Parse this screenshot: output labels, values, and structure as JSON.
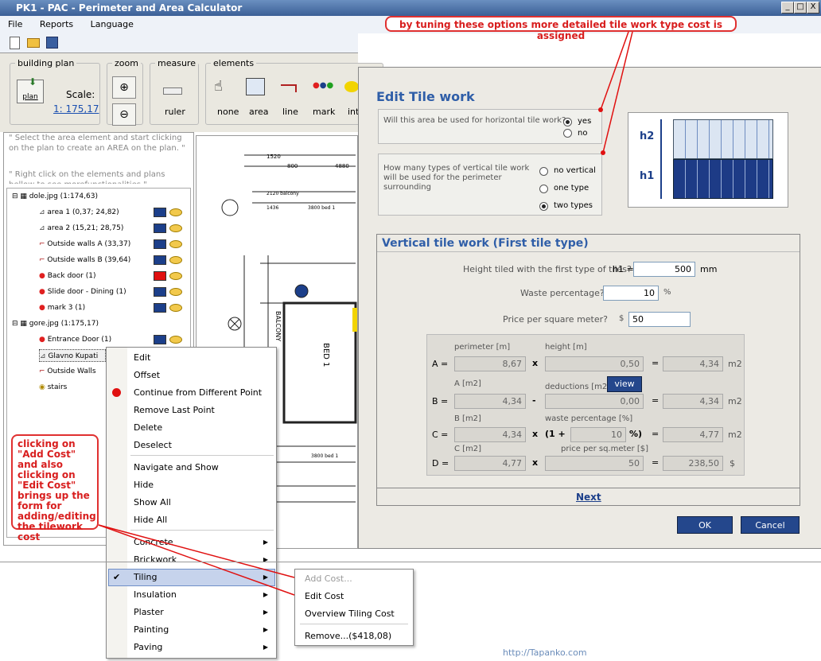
{
  "window": {
    "title": "PK1 - PAC - Perimeter and Area Calculator",
    "min": "_",
    "max": "□",
    "close": "X"
  },
  "menu": [
    "File",
    "Reports",
    "Language"
  ],
  "ribbon": {
    "building_plan": {
      "legend": "building plan",
      "btn": "plan",
      "scale_label": "Scale:",
      "scale_value": "1: 175,17"
    },
    "zoom": {
      "legend": "zoom"
    },
    "measure": {
      "legend": "measure",
      "ruler": "ruler"
    },
    "elements": {
      "legend": "elements",
      "items": [
        "none",
        "area",
        "line",
        "mark",
        "int"
      ]
    }
  },
  "hints": [
    "\" Select the area element and start clicking on the plan to create an AREA on the plan. \"",
    "\" Right click on the elements and plans bellow to see morefunctionalities \""
  ],
  "tree": {
    "plan1": "dole.jpg (1:174,63)",
    "items1": [
      {
        "label": "area 1 (0,37; 24,82)",
        "color": "#1c3f8a"
      },
      {
        "label": "area 2 (15,21; 28,75)",
        "color": "#1c3f8a"
      },
      {
        "label": "Outside walls A (33,37)",
        "color": "#1c3f8a"
      },
      {
        "label": "Outside walls B (39,64)",
        "color": "#1c3f8a"
      },
      {
        "label": "Back door (1)",
        "color": "#e01010"
      },
      {
        "label": "Slide door - Dining (1)",
        "color": "#1c3f8a"
      },
      {
        "label": "mark 3 (1)",
        "color": "#1c3f8a"
      }
    ],
    "plan2": "gore.jpg (1:175,17)",
    "items2": [
      {
        "label": "Entrance Door (1)",
        "color": "#1c3f8a"
      },
      {
        "label": "Glavno Kupati",
        "color": ""
      },
      {
        "label": "Outside Walls",
        "color": ""
      },
      {
        "label": "stairs",
        "color": ""
      }
    ]
  },
  "plan_texts": [
    "1520",
    "4880",
    "800",
    "2120 balcony",
    "1436",
    "3800 bed 1",
    "BALCONY",
    "BED 1",
    "3800 bed 1"
  ],
  "dialog": {
    "title": "Edit Tile work",
    "q1": "Will this area be used for horizontal tile work?",
    "q1_opts": [
      "yes",
      "no"
    ],
    "q2": "How many types of vertical tile work will be used for the perimeter surrounding",
    "q2_opts": [
      "no vertical",
      "one type",
      "two types"
    ],
    "diagram_labels": [
      "h2",
      "h1"
    ],
    "section": "Vertical tile work (First tile type)",
    "height_label": "Height tiled with the first type of tiles?",
    "height_sym": "h1 =",
    "height_value": "500",
    "height_unit": "mm",
    "waste_label": "Waste percentage?",
    "waste_value": "10",
    "waste_unit": "%",
    "price_label": "Price per square meter?",
    "price_sym": "$",
    "price_value": "50",
    "calc": {
      "A": {
        "name": "A =",
        "l1": "perimeter [m]",
        "v1": "8,67",
        "op": "x",
        "l2": "height [m]",
        "v2": "0,50",
        "eq": "=",
        "res": "4,34",
        "unit": "m2"
      },
      "B": {
        "name": "B =",
        "l1": "A [m2]",
        "v1": "4,34",
        "op": "-",
        "l2": "deductions [m2]",
        "view": "view",
        "v2": "0,00",
        "eq": "=",
        "res": "4,34",
        "unit": "m2"
      },
      "C": {
        "name": "C =",
        "l1": "B [m2]",
        "v1": "4,34",
        "op": "x",
        "l2": "waste percentage [%]",
        "pre": "(1 +",
        "v2": "10",
        "post": "%)",
        "eq": "=",
        "res": "4,77",
        "unit": "m2"
      },
      "D": {
        "name": "D =",
        "l1": "C [m2]",
        "v1": "4,77",
        "op": "x",
        "l2": "price per sq.meter [$]",
        "v2": "50",
        "eq": "=",
        "res": "238,50",
        "unit": "$"
      }
    },
    "next": "Next",
    "ok": "OK",
    "cancel": "Cancel"
  },
  "context_menu": [
    "Edit",
    "Offset",
    "Continue from Different Point",
    "Remove Last Point",
    "Delete",
    "Deselect",
    "Navigate and Show",
    "Hide",
    "Show All",
    "Hide All",
    "Concrete",
    "Brickwork",
    "Tiling",
    "Insulation",
    "Plaster",
    "Painting",
    "Paving"
  ],
  "submenu": [
    "Add Cost...",
    "Edit Cost",
    "Overview Tiling Cost",
    "Remove...($418,08)"
  ],
  "callouts": {
    "top": "by tuning these options more detailed tile work type cost is assigned",
    "left": "clicking on \"Add Cost\" and also clicking on \"Edit Cost\" brings up the form for adding/editing the tilework cost"
  },
  "footer": "http://Tapanko.com"
}
